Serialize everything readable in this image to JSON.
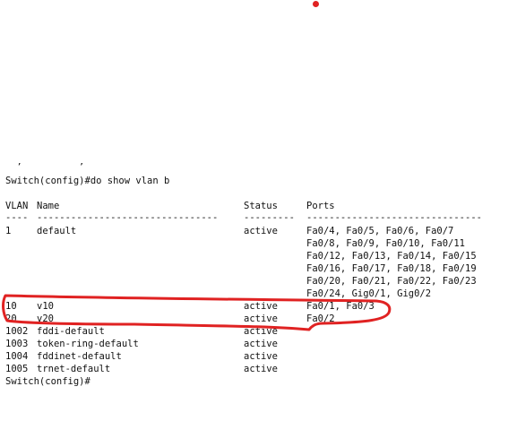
{
  "colors": {
    "annotation": "#e02222",
    "text": "#111111",
    "background": "#ffffff"
  },
  "terminal": {
    "cut_fragment": "  ,          ,",
    "command_line": "Switch(config)#do show vlan b",
    "header": {
      "vlan": "VLAN",
      "name": "Name",
      "status": "Status",
      "ports": "Ports"
    },
    "separator": {
      "vlan": "----",
      "name": "--------------------------------",
      "status": "---------",
      "ports": "-------------------------------"
    },
    "rows": [
      {
        "vlan": "1",
        "name": "default",
        "status": "active",
        "ports": [
          "Fa0/4, Fa0/5, Fa0/6, Fa0/7",
          "Fa0/8, Fa0/9, Fa0/10, Fa0/11",
          "Fa0/12, Fa0/13, Fa0/14, Fa0/15",
          "Fa0/16, Fa0/17, Fa0/18, Fa0/19",
          "Fa0/20, Fa0/21, Fa0/22, Fa0/23",
          "Fa0/24, Gig0/1, Gig0/2"
        ]
      },
      {
        "vlan": "10",
        "name": "v10",
        "status": "active",
        "ports": [
          "Fa0/1, Fa0/3"
        ]
      },
      {
        "vlan": "20",
        "name": "v20",
        "status": "active",
        "ports": [
          "Fa0/2"
        ]
      },
      {
        "vlan": "1002",
        "name": "fddi-default",
        "status": "active",
        "ports": [
          ""
        ]
      },
      {
        "vlan": "1003",
        "name": "token-ring-default",
        "status": "active",
        "ports": [
          ""
        ]
      },
      {
        "vlan": "1004",
        "name": "fddinet-default",
        "status": "active",
        "ports": [
          ""
        ]
      },
      {
        "vlan": "1005",
        "name": "trnet-default",
        "status": "active",
        "ports": [
          ""
        ]
      }
    ],
    "prompt": "Switch(config)#"
  }
}
